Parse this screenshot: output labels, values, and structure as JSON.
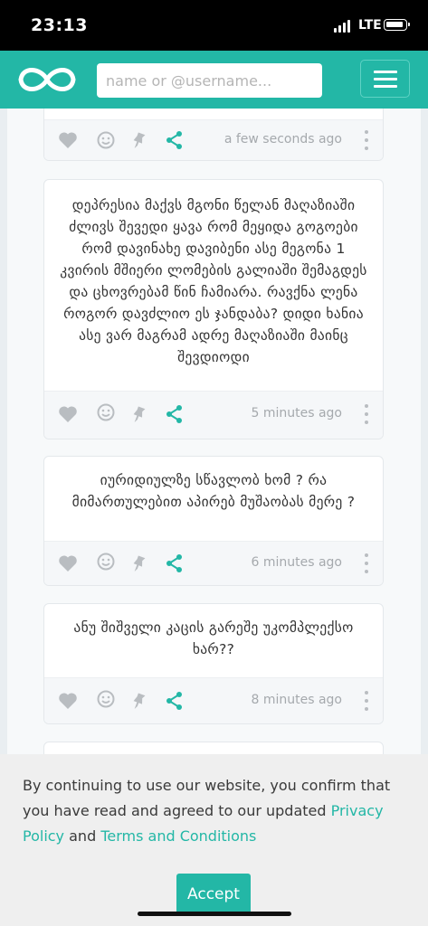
{
  "status_bar": {
    "time": "23:13",
    "network": "LTE"
  },
  "header": {
    "search_placeholder": "name or @username..."
  },
  "posts": [
    {
      "text": "",
      "timestamp": "a few seconds ago"
    },
    {
      "text": "დეპრესია მაქვს მგონი წელან მაღაზიაში ძლივს შევედი ყავა რომ მეყიდა გოგოები რომ დავინახე დავიბენი ასე მეგონა 1 კვირის მშიერი ლომების გალიაში შემაგდეს და ცხოვრებამ წინ ჩამიარა. რავქნა ლენა როგორ დავძლიო ეს ჯანდაბა? დიდი ხანია ასე ვარ მაგრამ ადრე მაღაზიაში მაინც შევდიოდი",
      "timestamp": "5 minutes ago"
    },
    {
      "text": "იურიდიულზე სწავლობ ხომ ? რა მიმართულებით აპირებ მუშაობას მერე ?",
      "timestamp": "6 minutes ago"
    },
    {
      "text": "ანუ შიშველი კაცის გარეშე უკომპლექსო ხარ??",
      "timestamp": "8 minutes ago"
    }
  ],
  "cookie": {
    "text_before": "By continuing to use our website, you confirm that you have read and agreed to our updated ",
    "privacy_link": "Privacy Policy",
    "and": " and ",
    "terms_link": "Terms and Conditions",
    "accept_label": "Accept"
  },
  "colors": {
    "brand": "#23b7a6",
    "footer_bg": "#f5f7f9",
    "icon_gray": "#b9bdc1"
  }
}
